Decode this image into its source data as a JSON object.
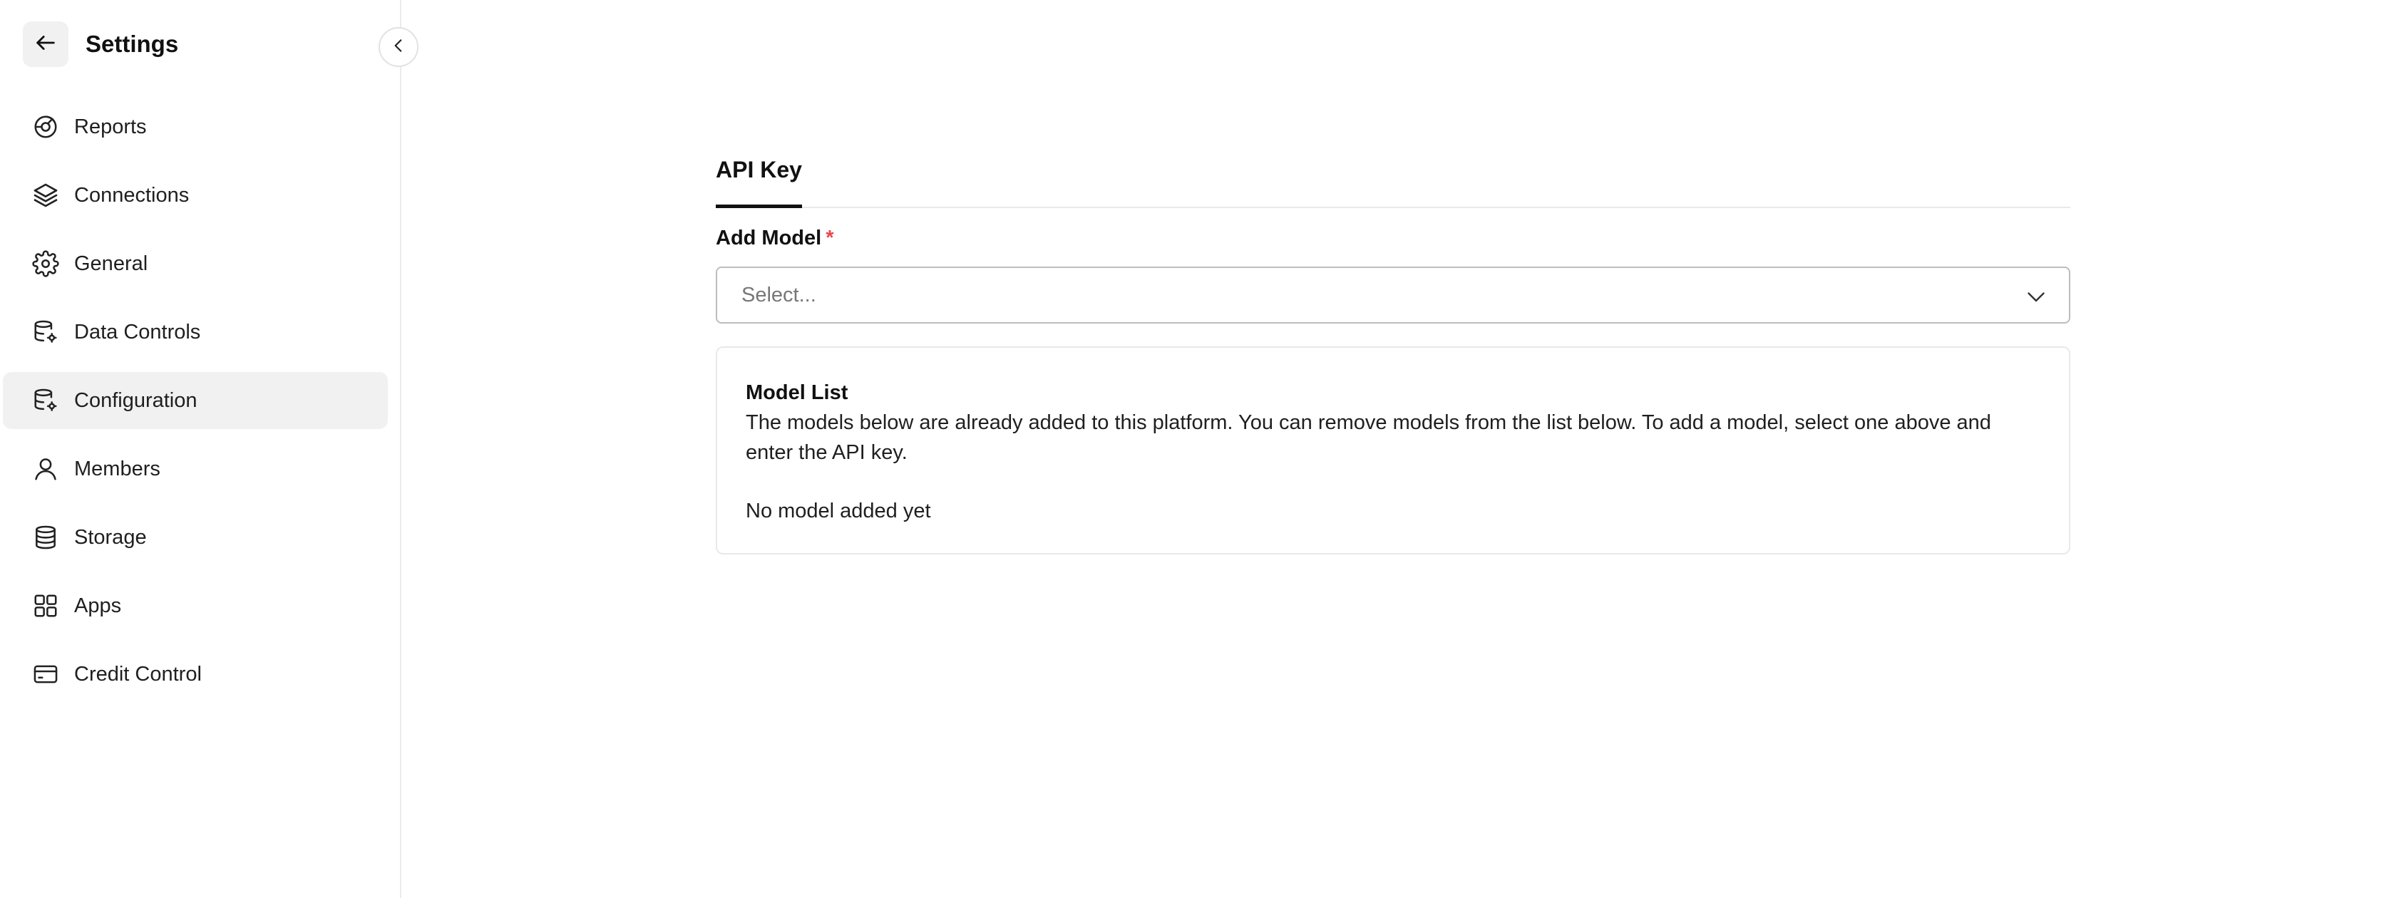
{
  "sidebar": {
    "title": "Settings",
    "items": [
      {
        "label": "Reports",
        "icon": "reports-icon",
        "active": false
      },
      {
        "label": "Connections",
        "icon": "layers-icon",
        "active": false
      },
      {
        "label": "General",
        "icon": "gear-icon",
        "active": false
      },
      {
        "label": "Data Controls",
        "icon": "database-gear-icon",
        "active": false
      },
      {
        "label": "Configuration",
        "icon": "database-gear-icon",
        "active": true
      },
      {
        "label": "Members",
        "icon": "user-icon",
        "active": false
      },
      {
        "label": "Storage",
        "icon": "storage-icon",
        "active": false
      },
      {
        "label": "Apps",
        "icon": "apps-grid-icon",
        "active": false
      },
      {
        "label": "Credit Control",
        "icon": "credit-card-icon",
        "active": false
      }
    ]
  },
  "main": {
    "tab": "API Key",
    "field_label": "Add Model",
    "required_mark": "*",
    "select_placeholder": "Select...",
    "card": {
      "title": "Model List",
      "description": "The models below are already added to this platform. You can remove models from the list below. To add a model, select one above and enter the API key.",
      "empty_text": "No model added yet"
    }
  },
  "colors": {
    "active_bg": "#f1f1f1",
    "border": "#e9e9e9",
    "required": "#e5484d",
    "text": "#1a1a1a"
  }
}
